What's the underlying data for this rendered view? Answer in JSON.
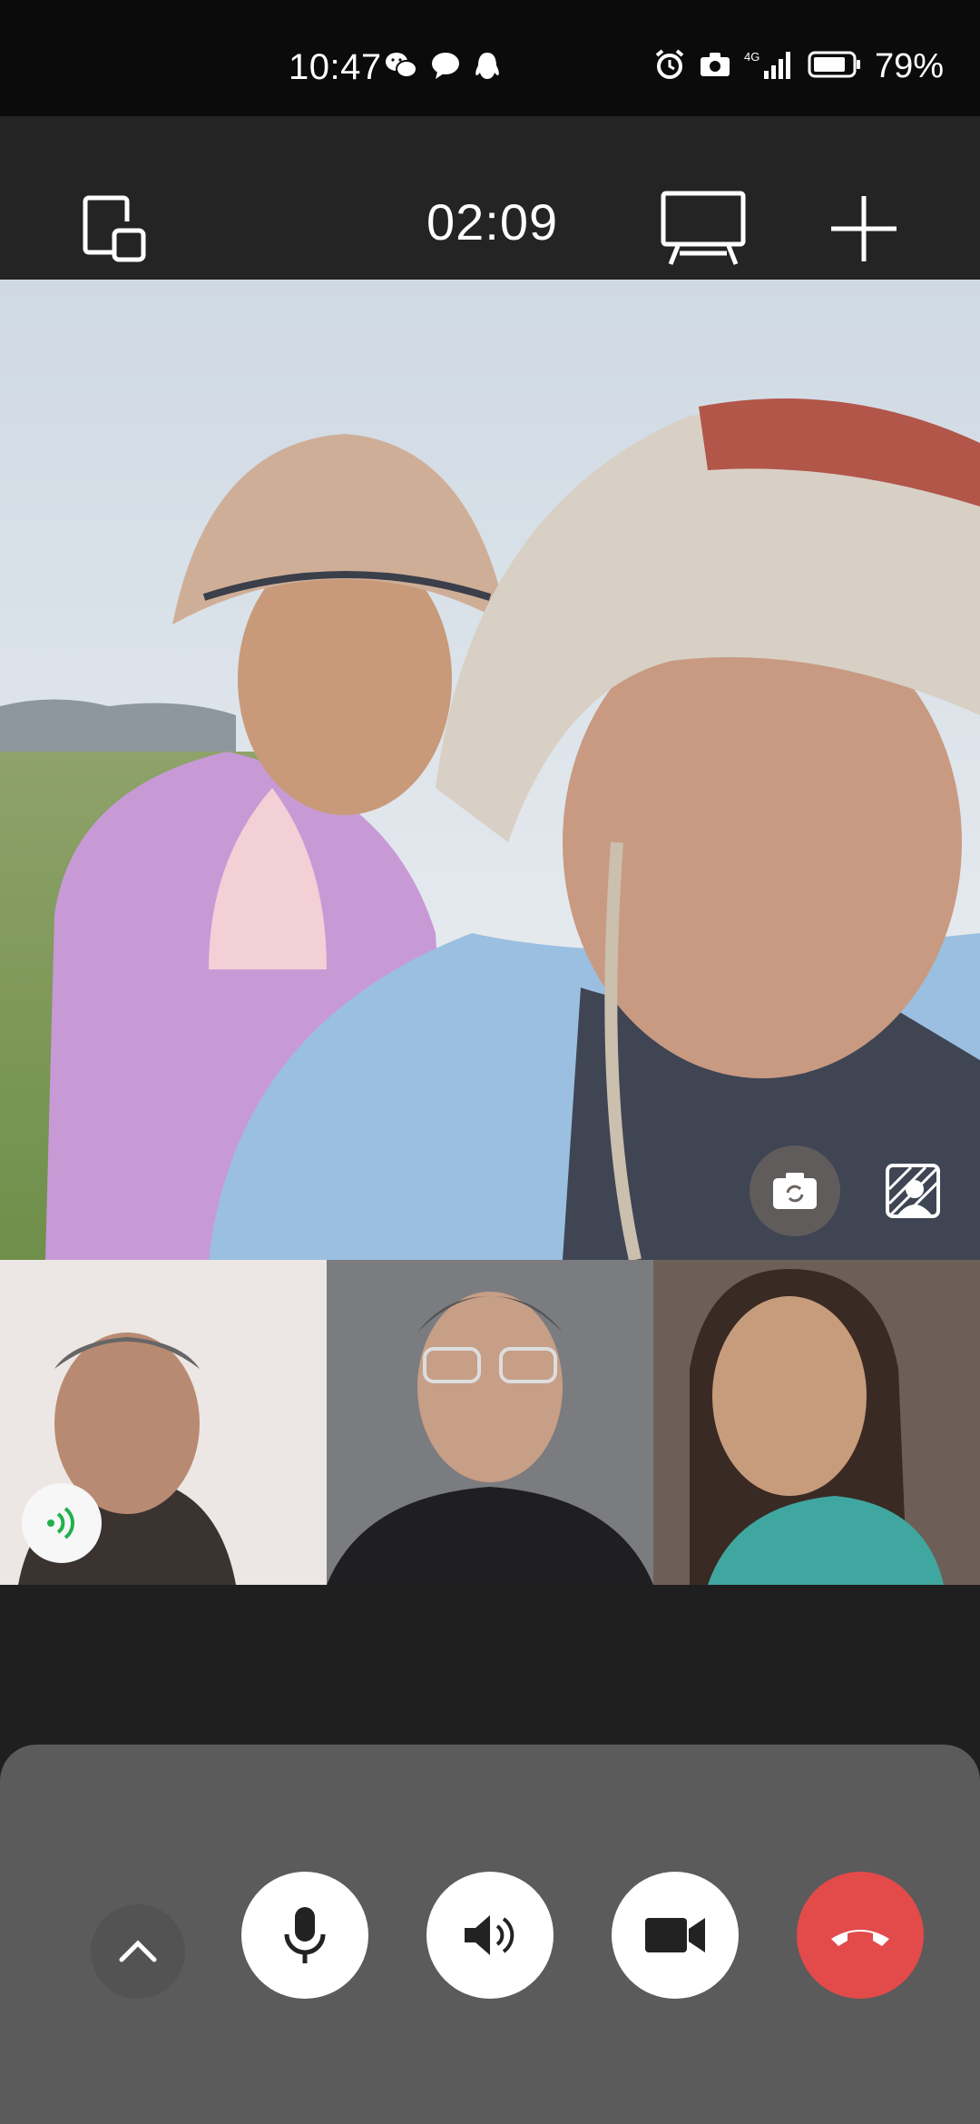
{
  "status_bar": {
    "time": "10:47",
    "battery": "79%",
    "network": "4G",
    "left_icons": [
      "wechat-icon",
      "message-icon",
      "qq-icon"
    ],
    "right_icons": [
      "alarm-icon",
      "camera-icon",
      "signal-icon",
      "battery-icon"
    ]
  },
  "call": {
    "timer": "02:09",
    "header_icons": [
      "minimize-window-icon",
      "screen-share-icon",
      "add-participant-icon"
    ]
  },
  "participants": [
    {
      "role": "main",
      "label": "main-video"
    },
    {
      "role": "thumbnail",
      "label": "participant-1",
      "speaking": true
    },
    {
      "role": "thumbnail",
      "label": "participant-2",
      "speaking": false
    },
    {
      "role": "thumbnail",
      "label": "participant-3",
      "speaking": false
    }
  ],
  "controls": {
    "buttons": [
      "expand",
      "microphone",
      "speaker",
      "camera",
      "hang-up"
    ],
    "colors": {
      "hangup": "#e34a4a",
      "speaking": "#21b14b",
      "panel": "#5b5b5b"
    }
  }
}
